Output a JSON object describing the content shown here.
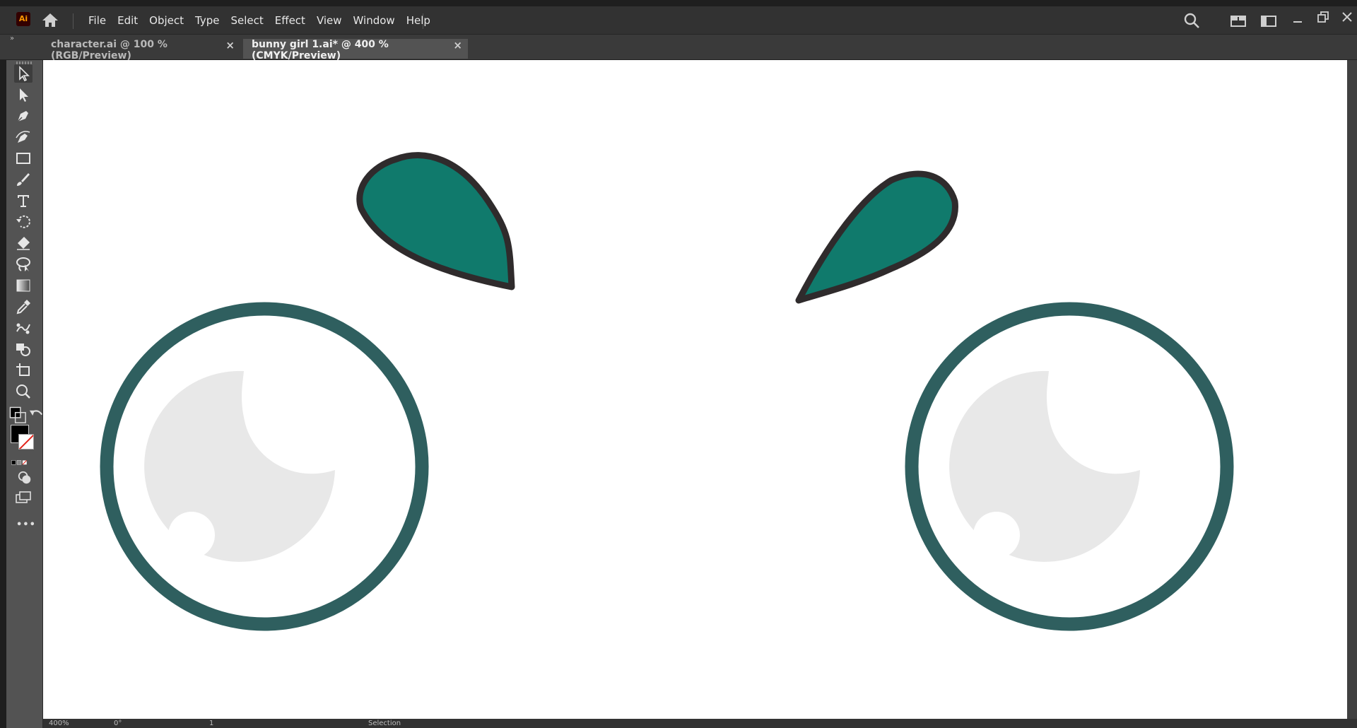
{
  "app": {
    "logo_text": "Ai"
  },
  "menu": [
    "File",
    "Edit",
    "Object",
    "Type",
    "Select",
    "Effect",
    "View",
    "Window",
    "Help"
  ],
  "tabs": [
    {
      "label": "character.ai @ 100 % (RGB/Preview)",
      "close": "×",
      "active": false
    },
    {
      "label": "bunny girl 1.ai* @ 400 % (CMYK/Preview)",
      "close": "×",
      "active": true
    }
  ],
  "toolbar": {
    "collapse_glyph": "»",
    "tools": [
      "selection-tool-icon",
      "direct-selection-tool-icon",
      "pen-tool-icon",
      "curvature-tool-icon",
      "rectangle-tool-icon",
      "paintbrush-tool-icon",
      "type-tool-icon",
      "rotate-tool-icon",
      "eraser-tool-icon",
      "lasso-tool-icon",
      "gradient-tool-icon",
      "eyedropper-tool-icon",
      "puppet-warp-tool-icon",
      "shape-builder-tool-icon",
      "artboard-tool-icon",
      "zoom-tool-icon"
    ],
    "more": "•••"
  },
  "colors": {
    "eyebrow_fill": "#107a6c",
    "eyebrow_stroke": "#2f2b2c",
    "eye_ring": "#2f5f5f",
    "iris": "#e8e8e8",
    "canvas": "#ffffff",
    "fill_swatch": "#000000"
  },
  "status": {
    "zoom": "400%",
    "rotation": "0°",
    "artboard": "1",
    "tool": "Selection"
  }
}
